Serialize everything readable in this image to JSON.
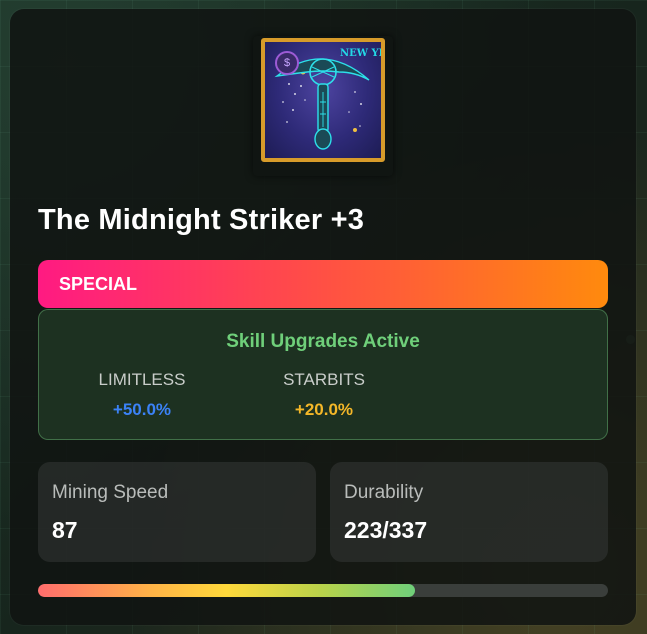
{
  "item": {
    "image_text": "NEW YEAR",
    "badge_text": "$",
    "title": "The Midnight Striker +3"
  },
  "rarity": {
    "label": "SPECIAL",
    "gradient_from": "#ff1a82",
    "gradient_to": "#ff8a0d"
  },
  "skills": {
    "heading": "Skill Upgrades Active",
    "items": [
      {
        "name": "LIMITLESS",
        "value": "+50.0%",
        "color": "#3b82f6"
      },
      {
        "name": "STARBITS",
        "value": "+20.0%",
        "color": "#f4b728"
      }
    ]
  },
  "stats": [
    {
      "label": "Mining Speed",
      "value": "87"
    },
    {
      "label": "Durability",
      "value": "223/337"
    }
  ],
  "durability": {
    "current": 223,
    "max": 337
  }
}
